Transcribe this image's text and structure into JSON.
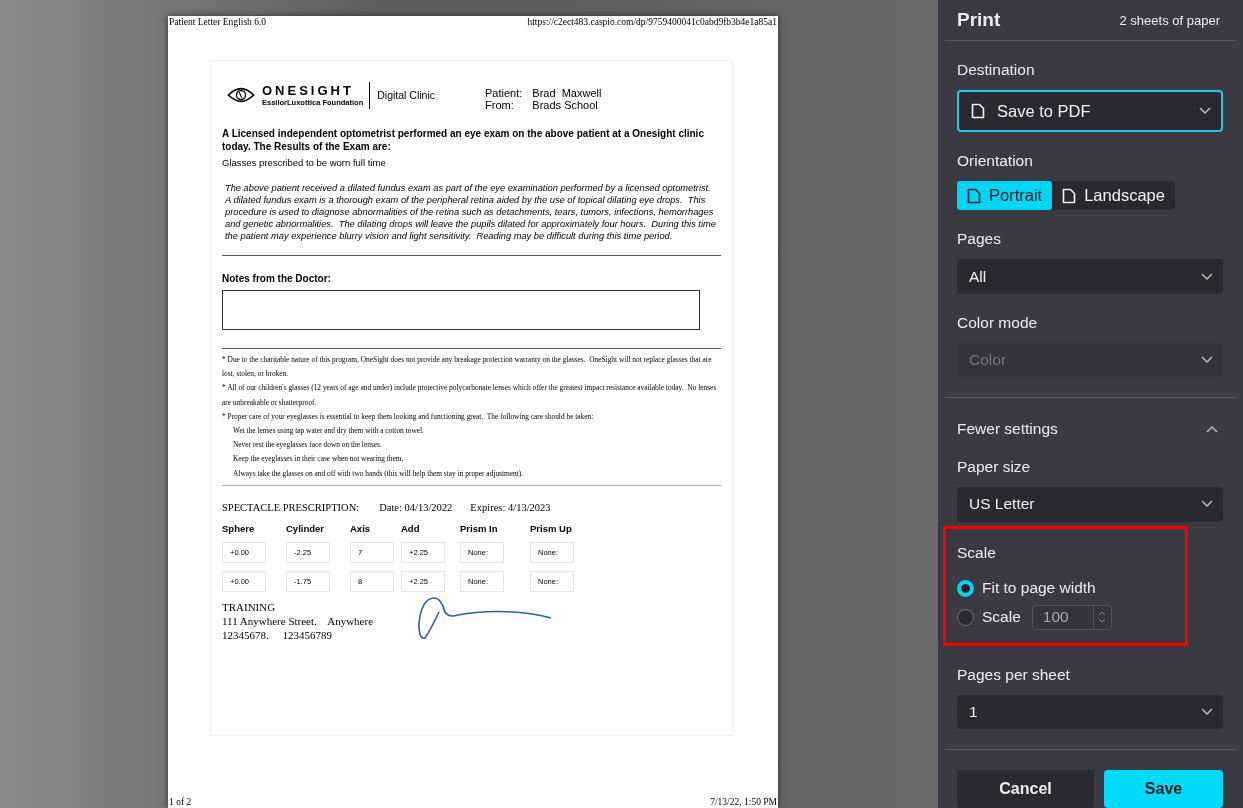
{
  "preview": {
    "header_left": "Patient Letter English 6.0",
    "header_right": "https://c2ect483.caspio.com/dp/9759400041c0abd9fb3b4e1a85a1",
    "footer_left": "1 of 2",
    "footer_right": "7/13/22, 1:50 PM",
    "letter": {
      "logo_name": "ONESIGHT",
      "logo_sub": "EssilorLuxottica Foundation",
      "clinic": "Digital Clinic",
      "patient_label": "Patient:",
      "patient": "Brad  Maxwell",
      "from_label": "From:",
      "from": "Brads School",
      "heading": "A Licensed independent optometrist performed an eye exam on the above patient at a Onesight clinic today. The Results of the Exam are:",
      "result": "Glasses prescribed to be worn full time",
      "note": "The above patient received a dilated fundus exam as part of the eye examination performed by a licensed optometrist.  A dilated fundus exam is a thorough exam of the peripheral retina aided by the use of topical dilating eye drops.  This procedure is used to diagnose abnormalities of the retina such as detachments, tears, tumors, infections, hemorrhages and genetic abnormalities.  The dilating drops will leave the pupils dilated for approximately four hours.  During this time the patient may experience blurry vision and light sensitivity.  Reading may be difficult during this time period.",
      "notes_title": "Notes from the Doctor:",
      "disclaimers": [
        {
          "kind": "bullet",
          "text": "* Due to the charitable nature of this program, OneSight does not provide any breakage protection warranty on the glasses.  OneSight will not replace glasses that are lost, stolen, or broken."
        },
        {
          "kind": "bullet",
          "text": "* All of our children's glasses (12 years of age and under) include protective polycarbonate lenses which offer the greatest impact resistance available today.  No lenses are unbreakable or shatterproof."
        },
        {
          "kind": "bullet",
          "text": "* Proper care of your eyeglasses is essential to keep them looking and functioning great.  The following care should be taken:"
        },
        {
          "kind": "care",
          "text": "Wet the lenses using tap water and dry them with a cotton towel."
        },
        {
          "kind": "care",
          "text": "Never rest the eyeglasses face down on the lenses."
        },
        {
          "kind": "care",
          "text": "Keep the eyeglasses in their case when not wearing them."
        },
        {
          "kind": "care",
          "text": "Always take the glasses on and off with two hands (this will help them stay in proper adjustment)."
        }
      ],
      "prescription": {
        "title": "SPECTACLE PRESCRIPTION:",
        "date": "Date: 04/13/2022",
        "expires": "Expires: 4/13/2023",
        "columns": [
          "Sphere",
          "Cylinder",
          "Axis",
          "Add",
          "Prism In",
          "Prism Up"
        ],
        "rows": [
          [
            "+0.00",
            "-2.25",
            "7",
            "+2.25",
            "None:",
            "None:"
          ],
          [
            "+0.00",
            "-1.75",
            "8",
            "+2.25",
            "None:",
            "None:"
          ]
        ]
      },
      "address": [
        "TRAINING",
        "111 Anywhere Street.    Anywhere",
        "12345678.     123456789"
      ]
    }
  },
  "panel": {
    "title": "Print",
    "sheets": "2 sheets of paper",
    "settings": [
      {
        "kind": "select",
        "label": "Destination",
        "value": "Save to PDF",
        "focused": true,
        "disabled": false
      },
      {
        "kind": "segmented",
        "label": "Orientation",
        "options": [
          {
            "label": "Portrait",
            "selected": true
          },
          {
            "label": "Landscape",
            "selected": false
          }
        ]
      },
      {
        "kind": "select",
        "label": "Pages",
        "value": "All",
        "focused": false,
        "disabled": false
      },
      {
        "kind": "select",
        "label": "Color mode",
        "value": "Color",
        "focused": false,
        "disabled": true
      },
      {
        "kind": "toggle",
        "label": "Fewer settings",
        "expanded": true
      },
      {
        "kind": "select",
        "label": "Paper size",
        "value": "US Letter",
        "focused": false,
        "disabled": false
      },
      {
        "kind": "radio",
        "label": "Scale",
        "highlighted": true,
        "options": [
          {
            "label": "Fit to page width",
            "selected": true
          },
          {
            "label": "Scale",
            "selected": false,
            "value": "100"
          }
        ]
      },
      {
        "kind": "select",
        "label": "Pages per sheet",
        "value": "1",
        "focused": false,
        "disabled": false
      }
    ],
    "buttons": [
      {
        "label": "Cancel",
        "kind": "secondary"
      },
      {
        "label": "Save",
        "kind": "primary"
      }
    ]
  }
}
